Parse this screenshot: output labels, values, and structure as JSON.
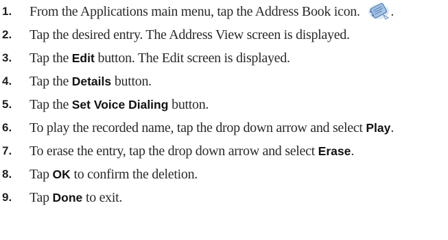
{
  "steps": [
    {
      "number": "1.",
      "parts": [
        {
          "text": "From the Applications main menu, tap the Address Book icon. ",
          "bold": false
        }
      ],
      "icon": "address-book-icon",
      "suffix": "."
    },
    {
      "number": "2.",
      "parts": [
        {
          "text": "Tap the desired entry. The Address View screen is displayed.",
          "bold": false
        }
      ]
    },
    {
      "number": "3.",
      "parts": [
        {
          "text": "Tap the ",
          "bold": false
        },
        {
          "text": "Edit",
          "bold": true
        },
        {
          "text": " button. The Edit screen is displayed.",
          "bold": false
        }
      ]
    },
    {
      "number": "4.",
      "parts": [
        {
          "text": "Tap the ",
          "bold": false
        },
        {
          "text": "Details",
          "bold": true
        },
        {
          "text": " button.",
          "bold": false
        }
      ]
    },
    {
      "number": "5.",
      "parts": [
        {
          "text": "Tap the ",
          "bold": false
        },
        {
          "text": "Set Voice Dialing",
          "bold": true
        },
        {
          "text": " button.",
          "bold": false
        }
      ]
    },
    {
      "number": "6.",
      "parts": [
        {
          "text": "To play the recorded name, tap the drop down arrow and select ",
          "bold": false
        },
        {
          "text": "Play",
          "bold": true
        },
        {
          "text": ".",
          "bold": false
        }
      ]
    },
    {
      "number": "7.",
      "parts": [
        {
          "text": "To erase the entry, tap the drop down arrow and select ",
          "bold": false
        },
        {
          "text": "Erase",
          "bold": true
        },
        {
          "text": ".",
          "bold": false
        }
      ]
    },
    {
      "number": "8.",
      "parts": [
        {
          "text": "Tap ",
          "bold": false
        },
        {
          "text": "OK",
          "bold": true
        },
        {
          "text": " to confirm the deletion.",
          "bold": false
        }
      ]
    },
    {
      "number": "9.",
      "parts": [
        {
          "text": "Tap ",
          "bold": false
        },
        {
          "text": "Done",
          "bold": true
        },
        {
          "text": " to exit.",
          "bold": false
        }
      ]
    }
  ],
  "colors": {
    "text": "#2a2a2a",
    "bold_text": "#111111",
    "icon_primary": "#5a86b8",
    "icon_secondary": "#a9c6e6"
  }
}
